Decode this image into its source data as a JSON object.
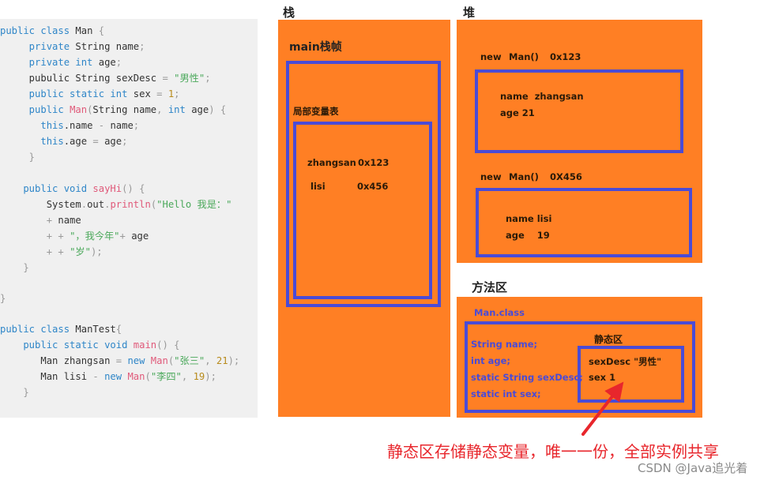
{
  "code": {
    "lines": [
      [
        {
          "t": "public class ",
          "c": "kw"
        },
        {
          "t": "Man ",
          "c": ""
        },
        {
          "t": "{",
          "c": "pun"
        }
      ],
      [
        {
          "t": "     private ",
          "c": "kw"
        },
        {
          "t": "String name",
          "c": ""
        },
        {
          "t": ";",
          "c": "pun"
        }
      ],
      [
        {
          "t": "     private int ",
          "c": "kw"
        },
        {
          "t": "age",
          "c": ""
        },
        {
          "t": ";",
          "c": "pun"
        }
      ],
      [
        {
          "t": "     pubulic String sexDesc ",
          "c": ""
        },
        {
          "t": "= ",
          "c": "pun"
        },
        {
          "t": "\"男性\"",
          "c": "str"
        },
        {
          "t": ";",
          "c": "pun"
        }
      ],
      [
        {
          "t": "     public static int ",
          "c": "kw"
        },
        {
          "t": "sex ",
          "c": ""
        },
        {
          "t": "= ",
          "c": "pun"
        },
        {
          "t": "1",
          "c": "num"
        },
        {
          "t": ";",
          "c": "pun"
        }
      ],
      [
        {
          "t": "     public ",
          "c": "kw"
        },
        {
          "t": "Man",
          "c": "fn"
        },
        {
          "t": "(",
          "c": "pun"
        },
        {
          "t": "String name",
          "c": ""
        },
        {
          "t": ", ",
          "c": "pun"
        },
        {
          "t": "int ",
          "c": "kw"
        },
        {
          "t": "age",
          "c": ""
        },
        {
          "t": ") {",
          "c": "pun"
        }
      ],
      [
        {
          "t": "       this",
          "c": "kw"
        },
        {
          "t": ".name ",
          "c": ""
        },
        {
          "t": "- ",
          "c": "pun"
        },
        {
          "t": "name",
          "c": ""
        },
        {
          "t": ";",
          "c": "pun"
        }
      ],
      [
        {
          "t": "       this",
          "c": "kw"
        },
        {
          "t": ".age ",
          "c": ""
        },
        {
          "t": "= ",
          "c": "pun"
        },
        {
          "t": "age",
          "c": ""
        },
        {
          "t": ";",
          "c": "pun"
        }
      ],
      [
        {
          "t": "     }",
          "c": "pun"
        }
      ],
      [],
      [
        {
          "t": "    public void ",
          "c": "kw"
        },
        {
          "t": "sayHi",
          "c": "fn"
        },
        {
          "t": "() {",
          "c": "pun"
        }
      ],
      [
        {
          "t": "        System",
          "c": ""
        },
        {
          "t": ".",
          "c": "pun"
        },
        {
          "t": "out",
          "c": ""
        },
        {
          "t": ".",
          "c": "pun"
        },
        {
          "t": "println",
          "c": "fn"
        },
        {
          "t": "(",
          "c": "pun"
        },
        {
          "t": "\"Hello 我是：\"",
          "c": "str"
        }
      ],
      [
        {
          "t": "        + ",
          "c": "pun"
        },
        {
          "t": "name",
          "c": ""
        }
      ],
      [
        {
          "t": "        + + ",
          "c": "pun"
        },
        {
          "t": "\"，我今年\"",
          "c": "str"
        },
        {
          "t": "+ ",
          "c": "pun"
        },
        {
          "t": "age",
          "c": ""
        }
      ],
      [
        {
          "t": "        + + ",
          "c": "pun"
        },
        {
          "t": "\"岁\"",
          "c": "str"
        },
        {
          "t": ");",
          "c": "pun"
        }
      ],
      [
        {
          "t": "    }",
          "c": "pun"
        }
      ],
      [],
      [
        {
          "t": "}",
          "c": "pun"
        }
      ],
      [],
      [
        {
          "t": "public class ",
          "c": "kw"
        },
        {
          "t": "ManTest",
          "c": ""
        },
        {
          "t": "{",
          "c": "pun"
        }
      ],
      [
        {
          "t": "    public static void ",
          "c": "kw"
        },
        {
          "t": "main",
          "c": "fn"
        },
        {
          "t": "() {",
          "c": "pun"
        }
      ],
      [
        {
          "t": "       Man zhangsan ",
          "c": ""
        },
        {
          "t": "= ",
          "c": "pun"
        },
        {
          "t": "new ",
          "c": "kw"
        },
        {
          "t": "Man",
          "c": "fn"
        },
        {
          "t": "(",
          "c": "pun"
        },
        {
          "t": "\"张三\"",
          "c": "str"
        },
        {
          "t": ", ",
          "c": "pun"
        },
        {
          "t": "21",
          "c": "num"
        },
        {
          "t": ");",
          "c": "pun"
        }
      ],
      [
        {
          "t": "       Man lisi ",
          "c": ""
        },
        {
          "t": "- ",
          "c": "pun"
        },
        {
          "t": "new ",
          "c": "kw"
        },
        {
          "t": "Man",
          "c": "fn"
        },
        {
          "t": "(",
          "c": "pun"
        },
        {
          "t": "\"李四\"",
          "c": "str"
        },
        {
          "t": ", ",
          "c": "pun"
        },
        {
          "t": "19",
          "c": "num"
        },
        {
          "t": ");",
          "c": "pun"
        }
      ],
      [
        {
          "t": "    }",
          "c": "pun"
        }
      ]
    ]
  },
  "stack": {
    "title": "栈",
    "frame_title": "main栈帧",
    "local_vars_title": "局部变量表",
    "vars": [
      {
        "name": "zhangsan",
        "value": "0x123"
      },
      {
        "name": "lisi",
        "value": "0x456"
      }
    ]
  },
  "heap": {
    "title": "堆",
    "objects": [
      {
        "header_new": "new",
        "header_ctor": "Man()",
        "address": "0x123",
        "field1": "name  zhangsan",
        "field2": "age 21"
      },
      {
        "header_new": "new",
        "header_ctor": "Man()",
        "address": "0X456",
        "field1": "name lisi",
        "field2": "age    19"
      }
    ]
  },
  "method_area": {
    "title": "方法区",
    "class_name": "Man.class",
    "members": [
      "String name;",
      "int age;",
      "static String sexDesc;",
      "static int sex;"
    ],
    "static_area_title": "静态区",
    "static_values": [
      "sexDesc \"男性\"",
      "sex 1"
    ]
  },
  "annotation": {
    "caption": "静态区存储静态变量，唯一一份，全部实例共享",
    "color": "#e8262c"
  },
  "watermark": "CSDN @Java追光着",
  "colors": {
    "orange": "#ff7f24",
    "blue": "#4a4bd6",
    "code_bg": "#f0f0f0"
  }
}
